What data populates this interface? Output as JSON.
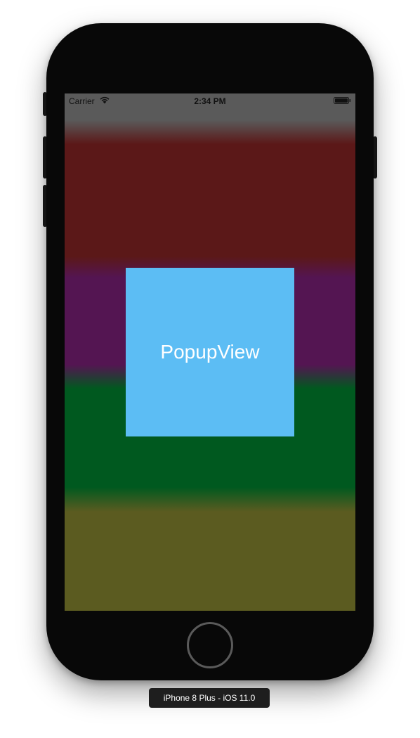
{
  "status_bar": {
    "carrier": "Carrier",
    "time": "2:34 PM",
    "wifi_icon": "wifi-icon",
    "battery_icon": "battery-icon"
  },
  "popup": {
    "label": "PopupView",
    "color": "#5cbdf4"
  },
  "background_stripes": {
    "colors": [
      "#5a5a5a",
      "#5b1818",
      "#541552",
      "#00591f",
      "#5b5b20"
    ]
  },
  "device": {
    "label": "iPhone 8 Plus - iOS 11.0"
  }
}
